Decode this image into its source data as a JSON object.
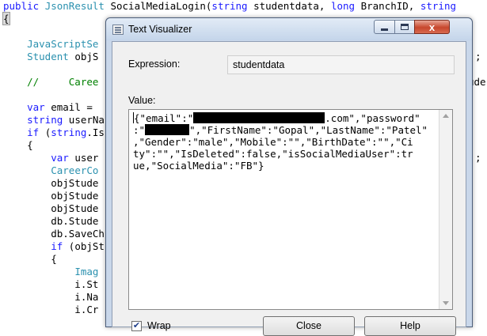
{
  "editor": {
    "lines": [
      {
        "tokens": [
          {
            "t": "public ",
            "c": "kw"
          },
          {
            "t": "JsonResult ",
            "c": "type"
          },
          {
            "t": "SocialMediaLogin(",
            "c": "plain"
          },
          {
            "t": "string ",
            "c": "kw"
          },
          {
            "t": "studentdata, ",
            "c": "plain"
          },
          {
            "t": "long ",
            "c": "kw"
          },
          {
            "t": "BranchID, ",
            "c": "plain"
          },
          {
            "t": "string",
            "c": "kw"
          }
        ]
      },
      {
        "tokens": [
          {
            "t": "{",
            "c": "plain"
          }
        ]
      },
      {
        "tokens": []
      },
      {
        "tokens": [
          {
            "t": "    JavaScriptSe",
            "c": "type"
          }
        ]
      },
      {
        "tokens": [
          {
            "t": "    ",
            "c": "plain"
          },
          {
            "t": "Student ",
            "c": "type"
          },
          {
            "t": "objS",
            "c": "plain"
          }
        ]
      },
      {
        "tokens": []
      },
      {
        "tokens": [
          {
            "t": "    //     Caree",
            "c": "cmt"
          }
        ]
      },
      {
        "tokens": []
      },
      {
        "tokens": [
          {
            "t": "    ",
            "c": "plain"
          },
          {
            "t": "var ",
            "c": "kw"
          },
          {
            "t": "email = ",
            "c": "plain"
          }
        ]
      },
      {
        "tokens": [
          {
            "t": "    ",
            "c": "plain"
          },
          {
            "t": "string ",
            "c": "kw"
          },
          {
            "t": "userNa",
            "c": "plain"
          }
        ]
      },
      {
        "tokens": [
          {
            "t": "    ",
            "c": "plain"
          },
          {
            "t": "if ",
            "c": "kw"
          },
          {
            "t": "(",
            "c": "plain"
          },
          {
            "t": "string",
            "c": "kw"
          },
          {
            "t": ".Is",
            "c": "plain"
          }
        ]
      },
      {
        "tokens": [
          {
            "t": "    {",
            "c": "plain"
          }
        ]
      },
      {
        "tokens": [
          {
            "t": "        ",
            "c": "plain"
          },
          {
            "t": "var ",
            "c": "kw"
          },
          {
            "t": "user",
            "c": "plain"
          }
        ]
      },
      {
        "tokens": [
          {
            "t": "        ",
            "c": "plain"
          },
          {
            "t": "CareerCo",
            "c": "type"
          }
        ]
      },
      {
        "tokens": [
          {
            "t": "        objStude",
            "c": "plain"
          }
        ]
      },
      {
        "tokens": [
          {
            "t": "        objStude",
            "c": "plain"
          }
        ]
      },
      {
        "tokens": [
          {
            "t": "        objStude",
            "c": "plain"
          }
        ]
      },
      {
        "tokens": [
          {
            "t": "        db.Stude",
            "c": "plain"
          }
        ]
      },
      {
        "tokens": [
          {
            "t": "        db.SaveCh",
            "c": "plain"
          }
        ]
      },
      {
        "tokens": [
          {
            "t": "        ",
            "c": "plain"
          },
          {
            "t": "if ",
            "c": "kw"
          },
          {
            "t": "(objSt",
            "c": "plain"
          }
        ]
      },
      {
        "tokens": [
          {
            "t": "        {",
            "c": "plain"
          }
        ]
      },
      {
        "tokens": [
          {
            "t": "            ",
            "c": "plain"
          },
          {
            "t": "Imag",
            "c": "type"
          }
        ]
      },
      {
        "tokens": [
          {
            "t": "            i.St",
            "c": "plain"
          }
        ]
      },
      {
        "tokens": [
          {
            "t": "            i.Na",
            "c": "plain"
          }
        ]
      },
      {
        "tokens": [
          {
            "t": "            i.Cr",
            "c": "plain"
          }
        ]
      }
    ],
    "right_fragments": [
      {
        "text": ";",
        "line": 4
      },
      {
        "text": "ude",
        "line": 6
      },
      {
        "text": ";",
        "line": 12
      }
    ]
  },
  "dialog": {
    "title": "Text Visualizer",
    "close_glyph": "x",
    "expression_label": "Expression:",
    "expression_value": "studentdata",
    "value_label": "Value:",
    "value_lines": [
      [
        {
          "t": "{\"email\":\""
        },
        {
          "redact": 166
        },
        {
          "t": ".com\",\"password\""
        }
      ],
      [
        {
          "t": ":\""
        },
        {
          "redact": 56
        },
        {
          "t": "\",\"FirstName\":\"Gopal\",\"LastName\":\"Patel\""
        }
      ],
      [
        {
          "t": ",\"Gender\":\"male\",\"Mobile\":\"\",\"BirthDate\":\"\",\"Ci"
        }
      ],
      [
        {
          "t": "ty\":\"\",\"IsDeleted\":false,\"isSocialMediaUser\":tr"
        }
      ],
      [
        {
          "t": "ue,\"SocialMedia\":\"FB\"}"
        }
      ]
    ],
    "wrap_label": "Wrap",
    "wrap_checked": true,
    "close_button": "Close",
    "help_button": "Help"
  }
}
